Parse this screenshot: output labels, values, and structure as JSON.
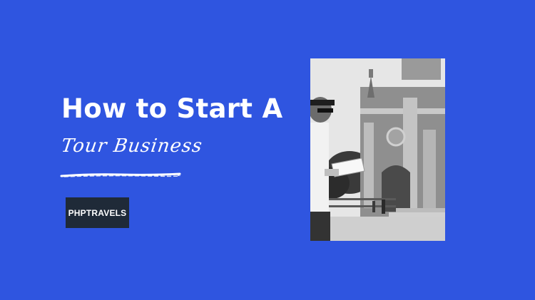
{
  "banner": {
    "title": "How to Start A",
    "subtitle": "Tour Business",
    "brand": "PHPTRAVELS",
    "colors": {
      "background": "#2f55e0",
      "text": "#ffffff",
      "badge": "#1f2a38"
    }
  }
}
